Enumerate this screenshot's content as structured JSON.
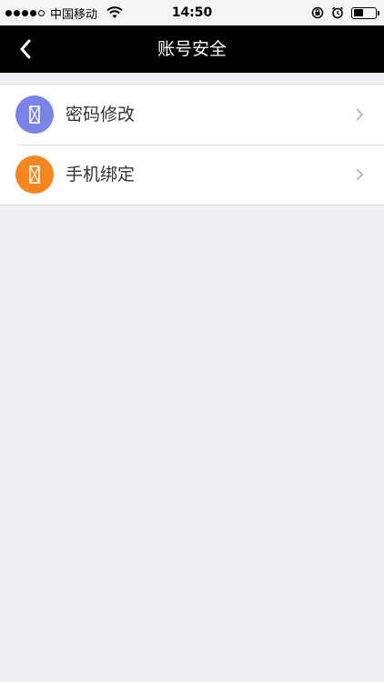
{
  "status_bar": {
    "carrier": "中国移动",
    "time": "14:50",
    "battery_level": 0.45
  },
  "nav": {
    "title": "账号安全"
  },
  "menu": {
    "items": [
      {
        "label": "密码修改",
        "icon": "password-icon",
        "color": "#7a83e8"
      },
      {
        "label": "手机绑定",
        "icon": "phone-icon",
        "color": "#f3861f"
      }
    ]
  }
}
